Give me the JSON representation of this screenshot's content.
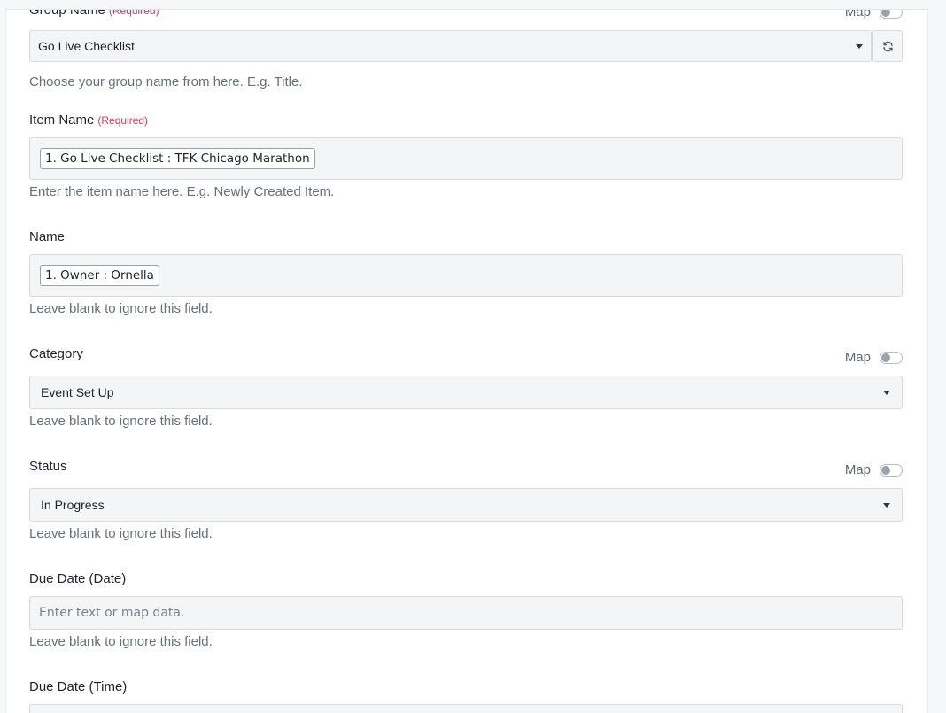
{
  "fields": {
    "group_name": {
      "label": "Group Name",
      "required": "(Required)",
      "map_label": "Map",
      "value": "Go Live Checklist",
      "help": "Choose your group name from here. E.g. Title."
    },
    "item_name": {
      "label": "Item Name",
      "required": "(Required)",
      "tag": "1. Go Live Checklist : TFK Chicago Marathon",
      "help": "Enter the item name here. E.g. Newly Created Item."
    },
    "name": {
      "label": "Name",
      "tag": "1. Owner : Ornella",
      "help": "Leave blank to ignore this field."
    },
    "category": {
      "label": "Category",
      "map_label": "Map",
      "value": "Event Set Up",
      "help": "Leave blank to ignore this field."
    },
    "status": {
      "label": "Status",
      "map_label": "Map",
      "value": "In Progress",
      "help": "Leave blank to ignore this field."
    },
    "due_date": {
      "label": "Due Date (Date)",
      "placeholder": "Enter text or map data.",
      "help": "Leave blank to ignore this field."
    },
    "due_time": {
      "label": "Due Date (Time)"
    }
  }
}
